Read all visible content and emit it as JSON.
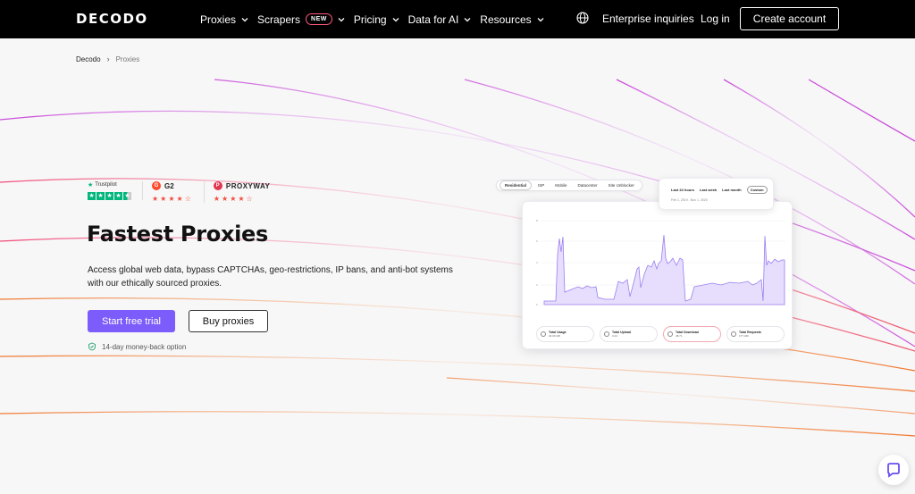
{
  "nav": {
    "logo": "DECODO",
    "items": [
      {
        "label": "Proxies",
        "has_dropdown": true
      },
      {
        "label": "Scrapers",
        "badge": "NEW",
        "has_dropdown": true
      },
      {
        "label": "Pricing",
        "has_dropdown": true
      },
      {
        "label": "Data for AI",
        "has_dropdown": true
      },
      {
        "label": "Resources",
        "has_dropdown": true
      }
    ],
    "enterprise": "Enterprise inquiries",
    "login": "Log in",
    "create_account": "Create account"
  },
  "breadcrumb": {
    "home": "Decodo",
    "current": "Proxies"
  },
  "ratings": {
    "trustpilot": "Trustpilot",
    "g2": "G2",
    "proxyway": "PROXYWAY"
  },
  "hero": {
    "title": "Fastest Proxies",
    "description": "Access global web data, bypass CAPTCHAs, geo-restrictions, IP bans, and anti-bot systems with our ethically sourced proxies.",
    "primary_button": "Start free trial",
    "secondary_button": "Buy proxies",
    "guarantee": "14-day money-back option"
  },
  "dashboard": {
    "tabs": [
      "Residential",
      "ISP",
      "Mobile",
      "Datacenter",
      "Site Unblocker"
    ],
    "active_tab": "Residential",
    "ranges": [
      "Last 24 hours",
      "Last week",
      "Last month",
      "Custom"
    ],
    "active_range": "Custom",
    "date_range": "Feb 1, 2019 - Nov 1, 2020",
    "stats": [
      {
        "label": "Total Usage",
        "value": "40.00 GB"
      },
      {
        "label": "Total Upload",
        "value": "0.24"
      },
      {
        "label": "Total Download",
        "value": "48.71"
      },
      {
        "label": "Total Requests",
        "value": "177,346"
      }
    ]
  },
  "colors": {
    "accent": "#7c5cfa",
    "nav_bg": "#000000",
    "trustpilot": "#00b67a",
    "stars_red": "#ef4f3e"
  }
}
